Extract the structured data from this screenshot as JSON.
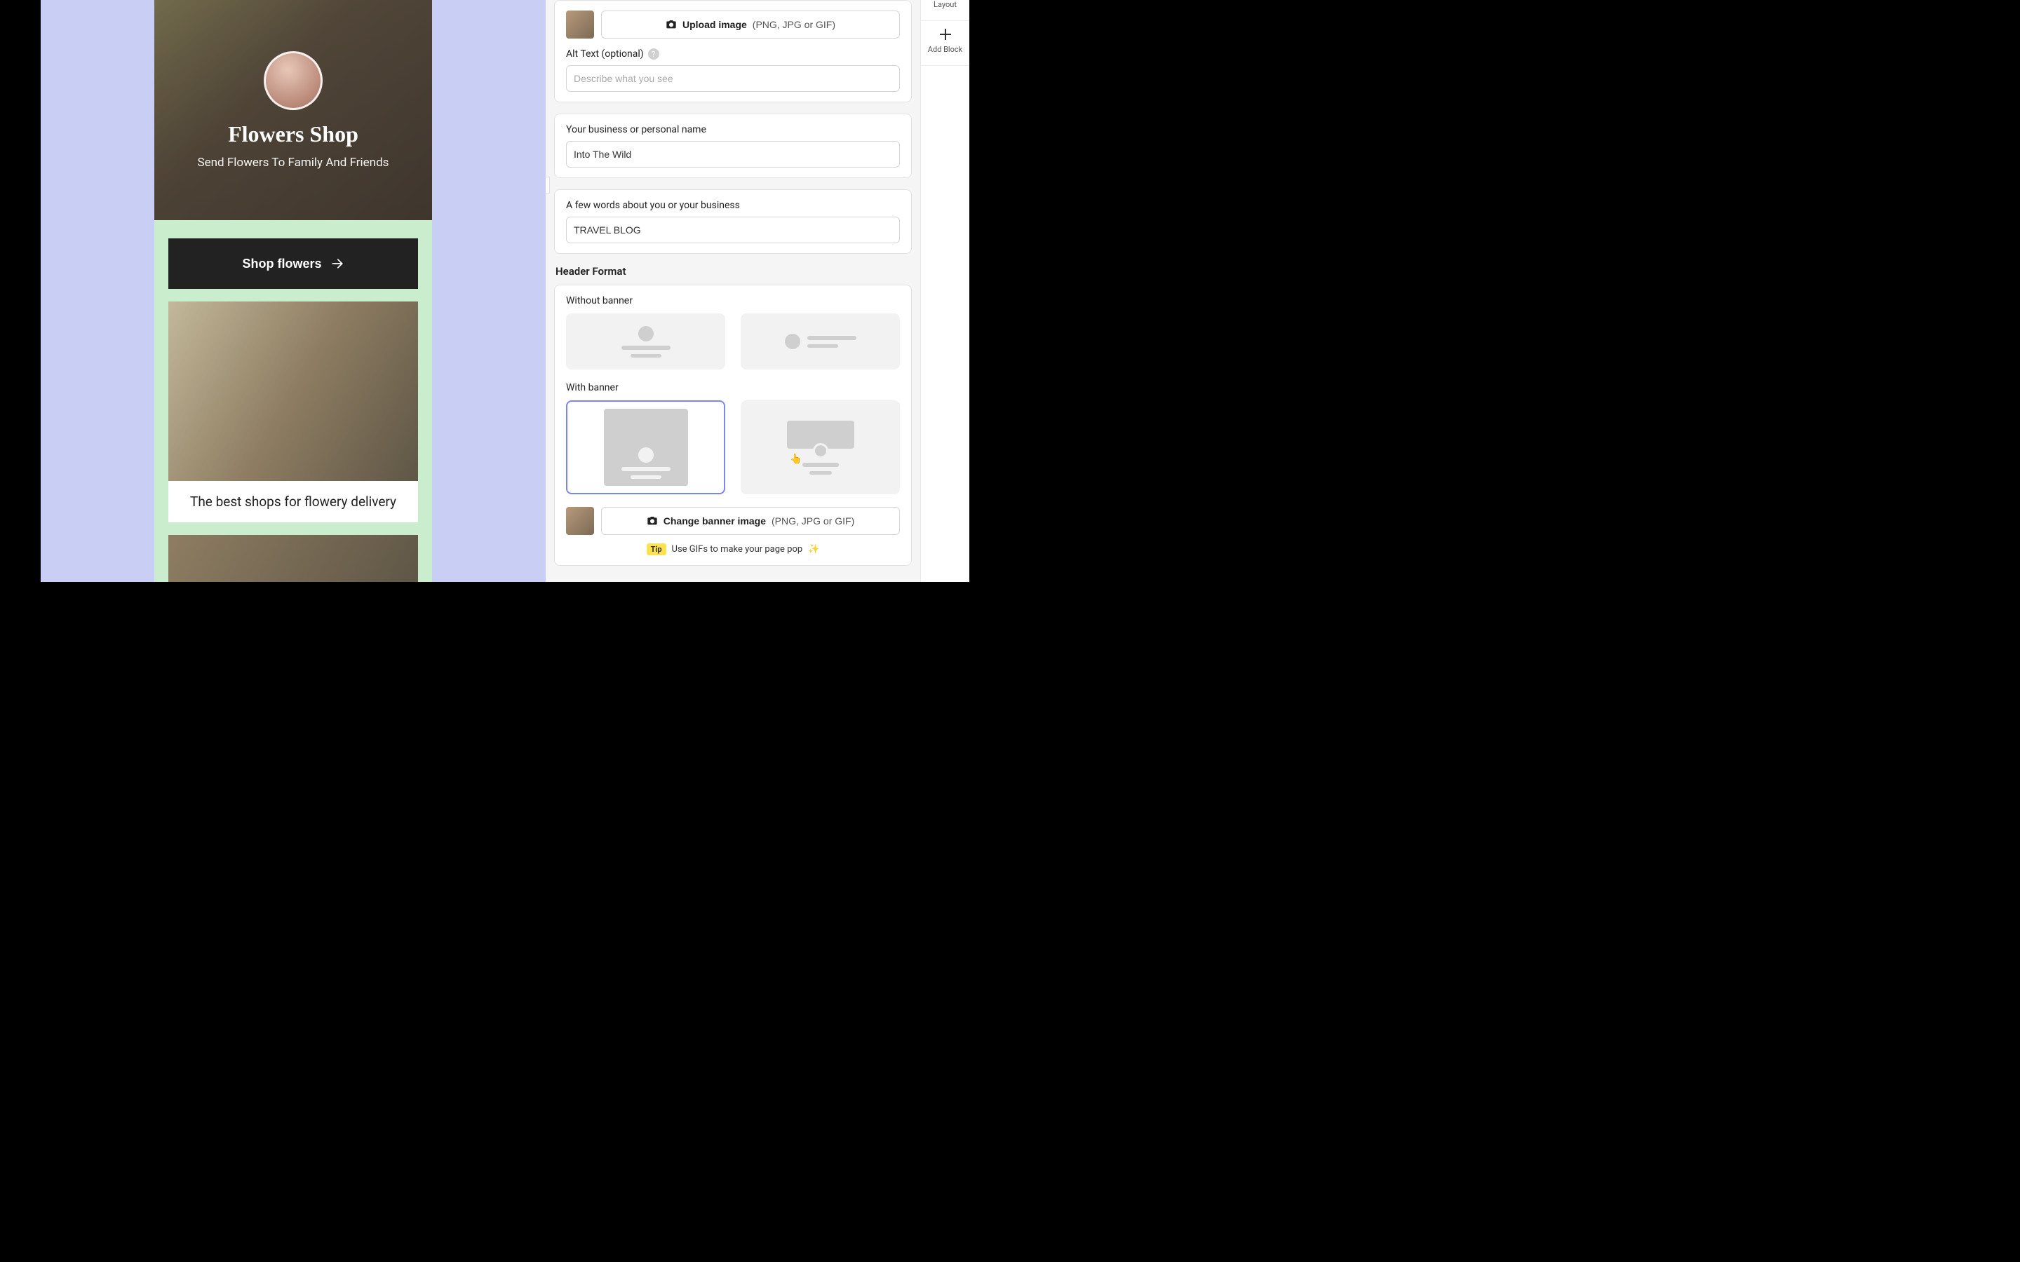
{
  "preview": {
    "hero_title": "Flowers Shop",
    "hero_subtitle": "Send Flowers To Family And Friends",
    "shop_button_label": "Shop flowers",
    "card_caption": "The best shops for flowery delivery"
  },
  "settings": {
    "upload_image_label": "Upload image",
    "upload_image_hint": "(PNG, JPG or GIF)",
    "alt_text_label": "Alt Text (optional)",
    "alt_text_placeholder": "Describe what you see",
    "business_name_label": "Your business or personal name",
    "business_name_value": "Into The Wild",
    "about_label": "A few words about you or your business",
    "about_value": "TRAVEL BLOG",
    "header_format_title": "Header Format",
    "without_banner_label": "Without banner",
    "with_banner_label": "With banner",
    "change_banner_label": "Change banner image",
    "change_banner_hint": "(PNG, JPG or GIF)",
    "tip_badge": "Tip",
    "tip_text": "Use GIFs to make your page pop",
    "tip_emoji": "✨"
  },
  "rail": {
    "layout_label": "Layout",
    "add_block_label": "Add Block"
  }
}
